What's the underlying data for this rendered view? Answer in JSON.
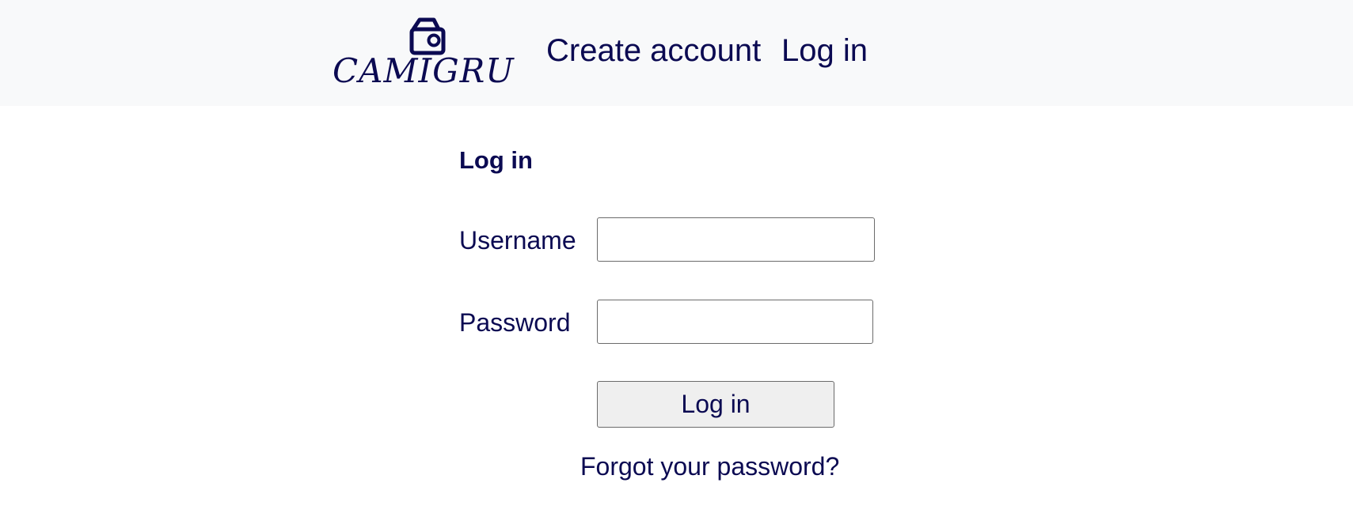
{
  "header": {
    "logo": {
      "text": "CAMIGRU",
      "icon": "camera-icon"
    },
    "nav": [
      {
        "label": "Create account"
      },
      {
        "label": "Log in"
      }
    ]
  },
  "form": {
    "title": "Log in",
    "username": {
      "label": "Username",
      "value": "",
      "placeholder": ""
    },
    "password": {
      "label": "Password",
      "value": "",
      "placeholder": ""
    },
    "submit_label": "Log in",
    "forgot_label": "Forgot your password?"
  },
  "colors": {
    "text": "#0b0a52",
    "header_bg": "#f8f9fa",
    "button_bg": "#efefef"
  }
}
